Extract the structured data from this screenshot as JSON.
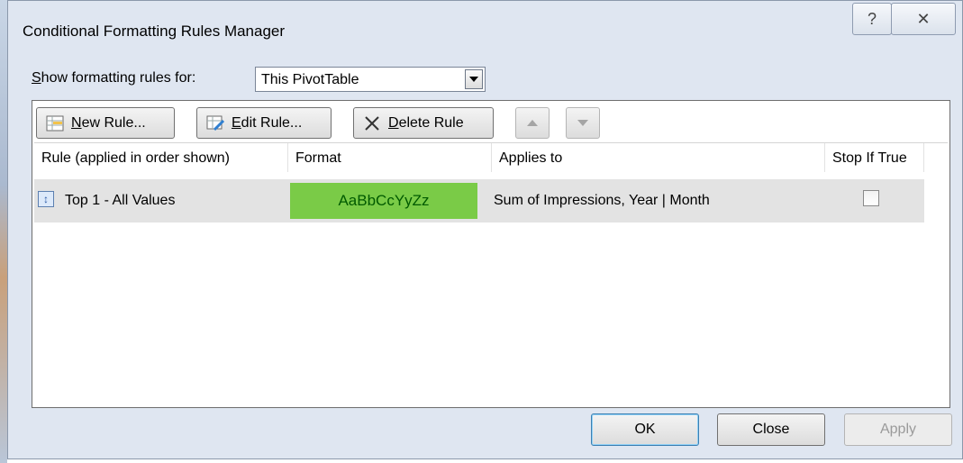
{
  "window": {
    "title": "Conditional Formatting Rules Manager",
    "help_glyph": "?",
    "close_glyph": "✕"
  },
  "scope": {
    "label_first": "S",
    "label_rest": "how formatting rules for:",
    "selected": "This PivotTable"
  },
  "toolbar": {
    "new_rule_u": "N",
    "new_rule_rest": "ew Rule...",
    "edit_rule_u": "E",
    "edit_rule_rest": "dit Rule...",
    "delete_rule_u": "D",
    "delete_rule_rest": "elete Rule"
  },
  "columns": [
    "Rule (applied in order shown)",
    "Format",
    "Applies to",
    "Stop If True"
  ],
  "rules": [
    {
      "rule": "Top 1 - All Values",
      "format_preview": "AaBbCcYyZz",
      "applies_to": "Sum of Impressions, Year | Month",
      "stop_if_true": false
    }
  ],
  "footer": {
    "ok": "OK",
    "close": "Close",
    "apply": "Apply"
  },
  "colors": {
    "format_fill": "#7acb47",
    "format_text": "#005a00",
    "dialog_bg": "#dfe6f1"
  }
}
